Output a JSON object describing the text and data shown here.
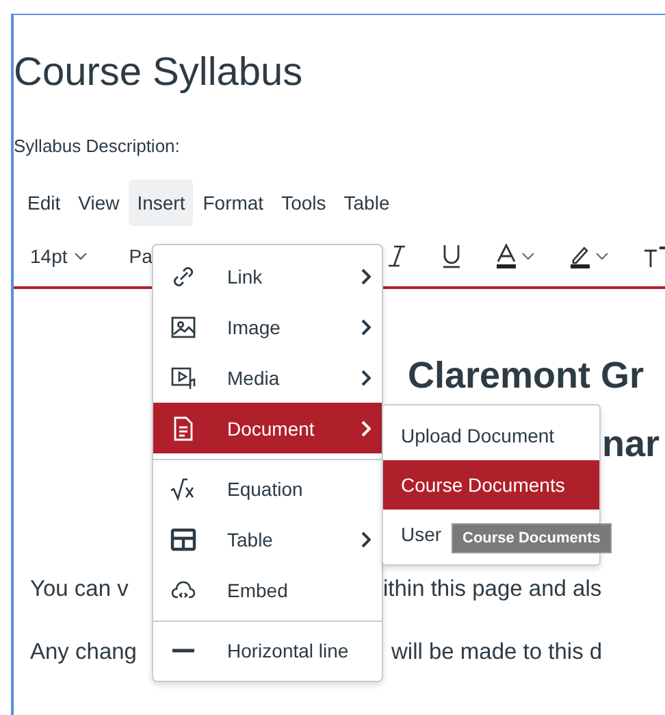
{
  "page_title": "Course Syllabus",
  "description_label": "Syllabus Description:",
  "menubar": [
    {
      "label": "Edit",
      "selected": false
    },
    {
      "label": "View",
      "selected": false
    },
    {
      "label": "Insert",
      "selected": true
    },
    {
      "label": "Format",
      "selected": false
    },
    {
      "label": "Tools",
      "selected": false
    },
    {
      "label": "Table",
      "selected": false
    }
  ],
  "toolbar": {
    "font_size": "14pt",
    "paragraph": "Pa"
  },
  "content": {
    "heading_line_1": "Claremont Gr",
    "heading_line_2": "nar",
    "paragraph_1": [
      "You can v",
      "ithin this page and als"
    ],
    "paragraph_2": [
      "Any chang",
      "will be made to this d"
    ]
  },
  "insert_menu": [
    {
      "label": "Link",
      "submenu": true,
      "selected": false,
      "divider_before": false
    },
    {
      "label": "Image",
      "submenu": true,
      "selected": false,
      "divider_before": false
    },
    {
      "label": "Media",
      "submenu": true,
      "selected": false,
      "divider_before": false
    },
    {
      "label": "Document",
      "submenu": true,
      "selected": true,
      "divider_before": false
    },
    {
      "label": "Equation",
      "submenu": false,
      "selected": false,
      "divider_before": true
    },
    {
      "label": "Table",
      "submenu": true,
      "selected": false,
      "divider_before": false
    },
    {
      "label": "Embed",
      "submenu": false,
      "selected": false,
      "divider_before": false
    },
    {
      "label": "Horizontal line",
      "submenu": false,
      "selected": false,
      "divider_before": true
    }
  ],
  "document_submenu": [
    {
      "label": "Upload Document",
      "selected": false
    },
    {
      "label": "Course Documents",
      "selected": true
    },
    {
      "label": "User",
      "selected": false
    }
  ],
  "tooltip": "Course Documents"
}
